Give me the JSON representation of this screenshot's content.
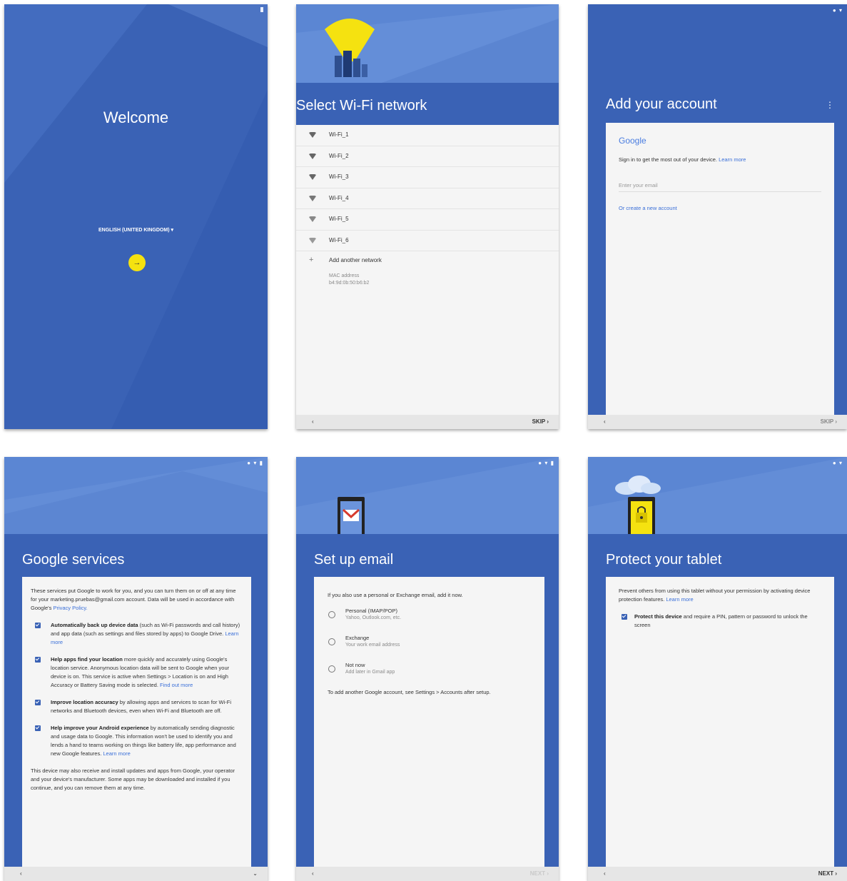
{
  "panel1": {
    "title": "Welcome",
    "language": "ENGLISH (UNITED KINGDOM) ▾",
    "start_arrow": "→"
  },
  "panel2": {
    "title": "Select Wi-Fi network",
    "networks": [
      "Wi-Fi_1",
      "Wi-Fi_2",
      "Wi-Fi_3",
      "Wi-Fi_4",
      "Wi-Fi_5",
      "Wi-Fi_6"
    ],
    "add_network": "Add another network",
    "mac_label": "MAC address",
    "mac_value": "b4:9d:0b:50:b6:b2",
    "back": "‹",
    "skip": "SKIP ›"
  },
  "panel3": {
    "title": "Add your account",
    "menu": "⋮",
    "google": "Google",
    "signin_text": "Sign in to get the most out of your device.",
    "learn_more": "Learn more",
    "email_placeholder": "Enter your email",
    "create_account": "Or create a new account",
    "back": "‹",
    "skip": "SKIP ›"
  },
  "panel4": {
    "title": "Google services",
    "intro_text": "These services put Google to work for you, and you can turn them on or off at any time for your marketing.pruebas@gmail.com account. Data will be used in accordance with Google's",
    "privacy_link": "Privacy Policy.",
    "items": [
      {
        "bold": "Automatically back up device data",
        "text": " (such as Wi-Fi passwords and call history) and app data (such as settings and files stored by apps) to Google Drive.",
        "link": "Learn more"
      },
      {
        "bold": "Help apps find your location",
        "text": " more quickly and accurately using Google's location service. Anonymous location data will be sent to Google when your device is on. This service is active when Settings > Location is on and High Accuracy or Battery Saving mode is selected.",
        "link": "Find out more"
      },
      {
        "bold": "Improve location accuracy",
        "text": " by allowing apps and services to scan for Wi-Fi networks and Bluetooth devices, even when Wi-Fi and Bluetooth are off.",
        "link": ""
      },
      {
        "bold": "Help improve your Android experience",
        "text": " by automatically sending diagnostic and usage data to Google. This information won't be used to identify you and lends a hand to teams working on things like battery life, app performance and new Google features.",
        "link": "Learn more"
      }
    ],
    "footer_text": "This device may also receive and install updates and apps from Google, your operator and your device's manufacturer. Some apps may be downloaded and installed if you continue, and you can remove them at any time.",
    "back": "‹",
    "more": "⌄"
  },
  "panel5": {
    "title": "Set up email",
    "intro": "If you also use a personal or Exchange email, add it now.",
    "options": [
      {
        "label": "Personal (IMAP/POP)",
        "sub": "Yahoo, Outlook.com, etc."
      },
      {
        "label": "Exchange",
        "sub": "Your work email address"
      },
      {
        "label": "Not now",
        "sub": "Add later in Gmail app"
      }
    ],
    "note": "To add another Google account, see Settings > Accounts after setup.",
    "back": "‹",
    "next": "NEXT ›"
  },
  "panel6": {
    "title": "Protect your tablet",
    "intro": "Prevent others from using this tablet without your permission by activating device protection features.",
    "learn_more": "Learn more",
    "option_bold": "Protect this device",
    "option_text": " and require a PIN, pattern or password to unlock the screen",
    "back": "‹",
    "next": "NEXT ›"
  },
  "colors": {
    "primary": "#3a62b5",
    "hero": "#5b86d3",
    "accent_yellow": "#f5e210",
    "link": "#3a6fd8"
  }
}
